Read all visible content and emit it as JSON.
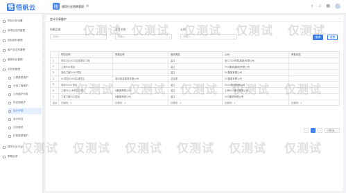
{
  "header": {
    "logo_char": "悟",
    "logo_text": "悟帆云",
    "app_chip": "院",
    "app_title": "通用行业销售管理",
    "title_icon": "⊜",
    "icons": [
      "search-icon",
      "bell-icon",
      "grid-icon",
      "user-avatar"
    ]
  },
  "sidebar": {
    "items": [
      {
        "label": "项目计划设置",
        "active": false,
        "sub": false
      },
      {
        "label": "场项目合同管理",
        "active": false,
        "sub": false
      },
      {
        "label": "招标投标管理",
        "active": false,
        "sub": false
      },
      {
        "label": "客户及关系管理",
        "active": false,
        "sub": false
      },
      {
        "label": "营销平台管理",
        "active": false,
        "sub": false
      },
      {
        "label": "业财务管理",
        "active": false,
        "sub": false
      },
      {
        "label": "工程类型维护",
        "active": false,
        "sub": true
      },
      {
        "label": "分包工程维护",
        "active": false,
        "sub": true
      },
      {
        "label": "公司维护列表",
        "active": false,
        "sub": true
      },
      {
        "label": "供应商维护",
        "active": false,
        "sub": true
      },
      {
        "label": "会计分录",
        "active": true,
        "sub": true
      },
      {
        "label": "会计科目",
        "active": false,
        "sub": true
      },
      {
        "label": "业务类型",
        "active": false,
        "sub": true
      },
      {
        "label": "付款类型维护",
        "active": false,
        "sub": true
      },
      {
        "label": "财务平台中心",
        "active": false,
        "sub": false
      },
      {
        "label": "帮助反馈",
        "active": false,
        "sub": false
      }
    ]
  },
  "tab": {
    "label": "会计分录维护"
  },
  "filters": {
    "f1_label": "所属区域",
    "f1_placeholder": "请输入",
    "f2_label": "项目名称",
    "f2_placeholder": "请输入",
    "f3_label": "公司",
    "f3_placeholder": "请输入"
  },
  "buttons": {
    "search": "查询",
    "reset": "重置"
  },
  "table": {
    "columns": [
      "",
      "项目名称",
      "所属区域",
      "组织类型",
      "公司",
      "审批状态"
    ],
    "rows": [
      [
        "1",
        "测评2021XXX区域项目工程",
        "",
        "监立",
        "浙江XXX有限(集团)有限公司",
        ""
      ],
      [
        "2",
        "工程XXX项目",
        "",
        "监立",
        "XXX集团(集团)有限公司",
        ""
      ],
      [
        "3",
        "测评工程XXXX项目",
        "",
        "监立",
        "XX集团有限公司",
        ""
      ],
      [
        "4",
        "XX项目XXXX区域项目",
        "湖州某某建筑有限公司",
        "总包项",
        "XX集团有限公司",
        ""
      ],
      [
        "5",
        "测评XXXX 项目",
        "",
        "监立",
        "XXXX集团有限公司",
        ""
      ],
      [
        "6",
        "工程XX土木项目工程",
        "A集团有限公司",
        "监立",
        "上海XXX建设有限公司",
        ""
      ],
      [
        "7",
        "工程工程XXX项目",
        "A集团有限公司",
        "监立",
        "XXX集团有限公司",
        ""
      ],
      [
        "合计",
        "已填写：1",
        "已填写：1",
        "已填写：1",
        "已填写：1",
        "已填写：1"
      ]
    ]
  },
  "pager": {
    "prev": "‹",
    "current": "1",
    "next": "›",
    "page_size": "10条/页"
  },
  "watermark_text": "仅测试"
}
